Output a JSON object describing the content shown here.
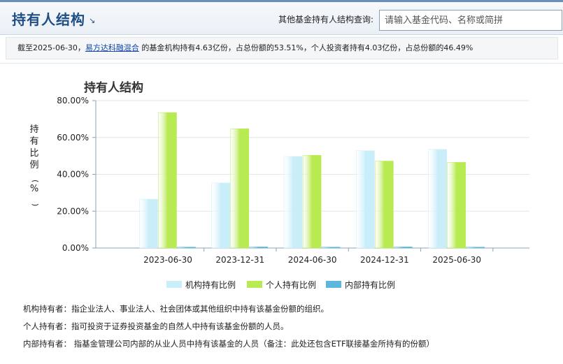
{
  "header": {
    "title": "持有人结构",
    "corner_icon": "arrow-down-right-icon",
    "query_label": "其他基金持有人结构查询:",
    "search_placeholder": "请输入基金代码、名称或简拼"
  },
  "summary": {
    "prefix": "截至2025-06-30，",
    "fund_link": "易方达科融混合",
    "suffix": " 的基金机构持有4.63亿份，占总份额的53.51%，个人投资者持有4.03亿份，占总份额的46.49%"
  },
  "chart_data": {
    "type": "bar",
    "title": "持有人结构",
    "ylabel": "持有比例（%）",
    "xlabel": "",
    "categories": [
      "2023-06-30",
      "2023-12-31",
      "2024-06-30",
      "2024-12-31",
      "2025-06-30"
    ],
    "ylim": [
      0,
      80
    ],
    "yticks": [
      "0.00%",
      "20.00%",
      "40.00%",
      "60.00%",
      "80.00%"
    ],
    "grid": true,
    "legend_position": "bottom",
    "series": [
      {
        "name": "机构持有比例",
        "color": "#c9eefa",
        "values": [
          26.5,
          35.3,
          49.7,
          52.8,
          53.51
        ]
      },
      {
        "name": "个人持有比例",
        "color": "#b8ea52",
        "values": [
          73.5,
          64.7,
          50.3,
          47.2,
          46.49
        ]
      },
      {
        "name": "内部持有比例",
        "color": "#5bb8dc",
        "values": [
          0.5,
          0.6,
          0.5,
          0.6,
          0.5
        ]
      }
    ]
  },
  "notes": [
    "机构持有者：指企业法人、事业法人、社会团体或其他组织中持有该基金份额的组织。",
    "个人持有者：指可投资于证券投资基金的自然人中持有该基金份额的人员。",
    "内部持有者： 指基金管理公司内部的从业人员中持有该基金的人员（备注：此处还包含ETF联接基金所持有的份额）"
  ]
}
